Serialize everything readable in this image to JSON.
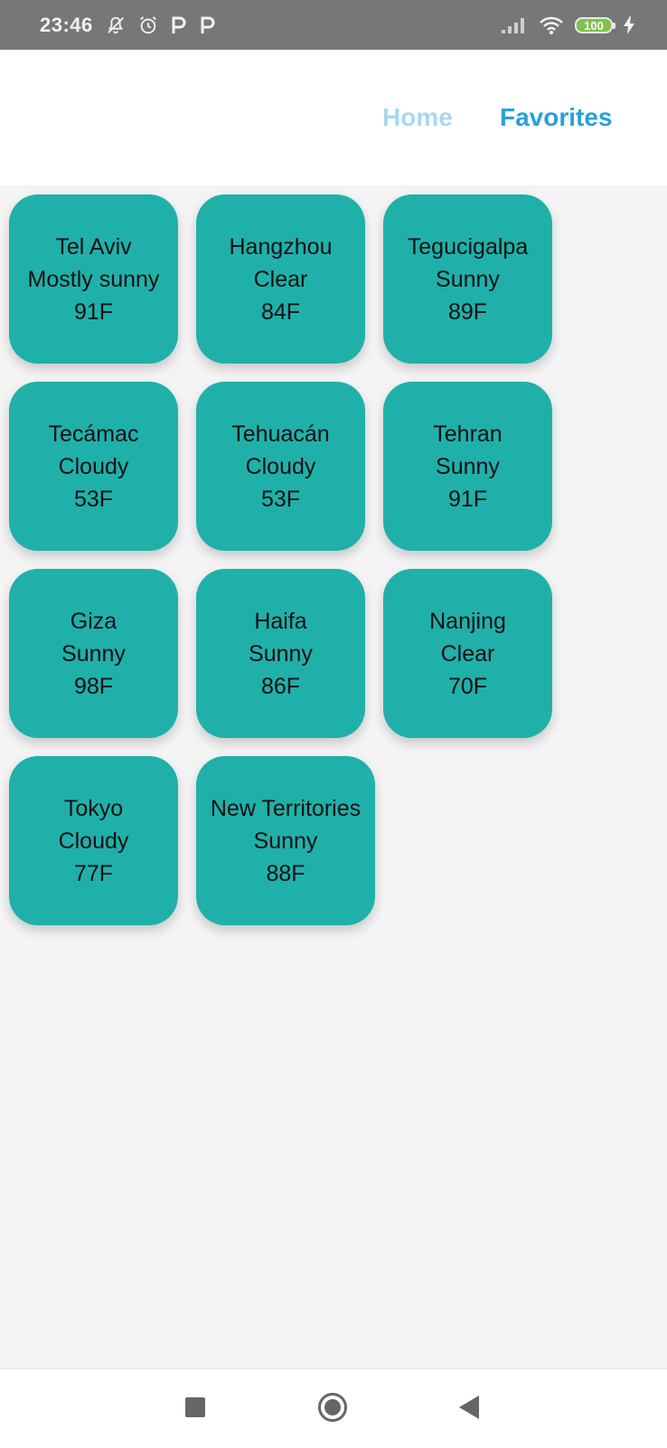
{
  "status_bar": {
    "time": "23:46",
    "battery": "100"
  },
  "header": {
    "nav": [
      {
        "label": "Home",
        "active": false
      },
      {
        "label": "Favorites",
        "active": true
      }
    ]
  },
  "colors": {
    "card": "#20b0aa",
    "nav_active": "#2a9fdd",
    "nav_inactive": "#a9d7ee",
    "status_bar": "#777777",
    "background": "#f4f4f4"
  },
  "cities": [
    {
      "name": "Tel Aviv",
      "condition": "Mostly sunny",
      "temp": "91F"
    },
    {
      "name": "Hangzhou",
      "condition": "Clear",
      "temp": "84F"
    },
    {
      "name": "Tegucigalpa",
      "condition": "Sunny",
      "temp": "89F"
    },
    {
      "name": "Tecámac",
      "condition": "Cloudy",
      "temp": "53F"
    },
    {
      "name": "Tehuacán",
      "condition": "Cloudy",
      "temp": "53F"
    },
    {
      "name": "Tehran",
      "condition": "Sunny",
      "temp": "91F"
    },
    {
      "name": "Giza",
      "condition": "Sunny",
      "temp": "98F"
    },
    {
      "name": "Haifa",
      "condition": "Sunny",
      "temp": "86F"
    },
    {
      "name": "Nanjing",
      "condition": "Clear",
      "temp": "70F"
    },
    {
      "name": "Tokyo",
      "condition": "Cloudy",
      "temp": "77F"
    },
    {
      "name": "New Territories",
      "condition": "Sunny",
      "temp": "88F"
    }
  ],
  "system_nav": {
    "icons": [
      "recents-square-icon",
      "home-circle-icon",
      "back-triangle-icon"
    ]
  }
}
